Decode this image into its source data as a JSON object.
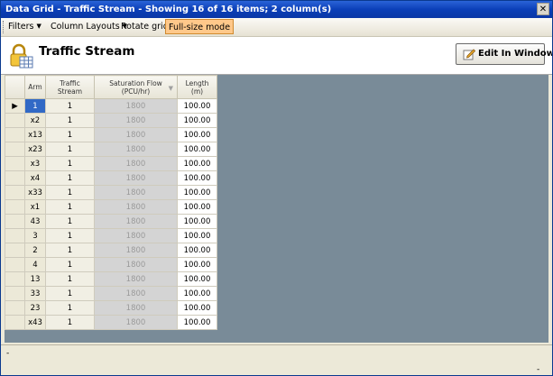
{
  "window": {
    "title": "Data Grid - Traffic Stream - Showing 16 of 16 items;  2 column(s)",
    "close_label": "✕"
  },
  "toolbar": {
    "filters_label": "Filters",
    "column_layouts_label": "Column Layouts",
    "rotate_grid_label": "Rotate grid",
    "full_size_mode_label": "Full-size mode",
    "caret": "▼"
  },
  "header": {
    "title": "Traffic Stream",
    "edit_button_label": "Edit In Window"
  },
  "grid": {
    "columns": {
      "arm": "Arm",
      "traffic_stream_1": "Traffic",
      "traffic_stream_2": "Stream",
      "saturation_flow_1": "Saturation Flow",
      "saturation_flow_2": "(PCU/hr)",
      "length_1": "Length",
      "length_2": "(m)"
    },
    "row_indicator": "▶",
    "rows": [
      {
        "arm": "1",
        "traffic_stream": "1",
        "saturation_flow": "1800",
        "length": "100.00"
      },
      {
        "arm": "x2",
        "traffic_stream": "1",
        "saturation_flow": "1800",
        "length": "100.00"
      },
      {
        "arm": "x13",
        "traffic_stream": "1",
        "saturation_flow": "1800",
        "length": "100.00"
      },
      {
        "arm": "x23",
        "traffic_stream": "1",
        "saturation_flow": "1800",
        "length": "100.00"
      },
      {
        "arm": "x3",
        "traffic_stream": "1",
        "saturation_flow": "1800",
        "length": "100.00"
      },
      {
        "arm": "x4",
        "traffic_stream": "1",
        "saturation_flow": "1800",
        "length": "100.00"
      },
      {
        "arm": "x33",
        "traffic_stream": "1",
        "saturation_flow": "1800",
        "length": "100.00"
      },
      {
        "arm": "x1",
        "traffic_stream": "1",
        "saturation_flow": "1800",
        "length": "100.00"
      },
      {
        "arm": "43",
        "traffic_stream": "1",
        "saturation_flow": "1800",
        "length": "100.00"
      },
      {
        "arm": "3",
        "traffic_stream": "1",
        "saturation_flow": "1800",
        "length": "100.00"
      },
      {
        "arm": "2",
        "traffic_stream": "1",
        "saturation_flow": "1800",
        "length": "100.00"
      },
      {
        "arm": "4",
        "traffic_stream": "1",
        "saturation_flow": "1800",
        "length": "100.00"
      },
      {
        "arm": "13",
        "traffic_stream": "1",
        "saturation_flow": "1800",
        "length": "100.00"
      },
      {
        "arm": "33",
        "traffic_stream": "1",
        "saturation_flow": "1800",
        "length": "100.00"
      },
      {
        "arm": "23",
        "traffic_stream": "1",
        "saturation_flow": "1800",
        "length": "100.00"
      },
      {
        "arm": "x43",
        "traffic_stream": "1",
        "saturation_flow": "1800",
        "length": "100.00"
      }
    ]
  },
  "status": {
    "left_text": "-",
    "right_text": "-"
  },
  "colors": {
    "titlebar": "#0b3fb8",
    "grid_background": "#798b98",
    "selected_cell": "#3169c6",
    "active_toolbar_item": "#ffc88a"
  }
}
